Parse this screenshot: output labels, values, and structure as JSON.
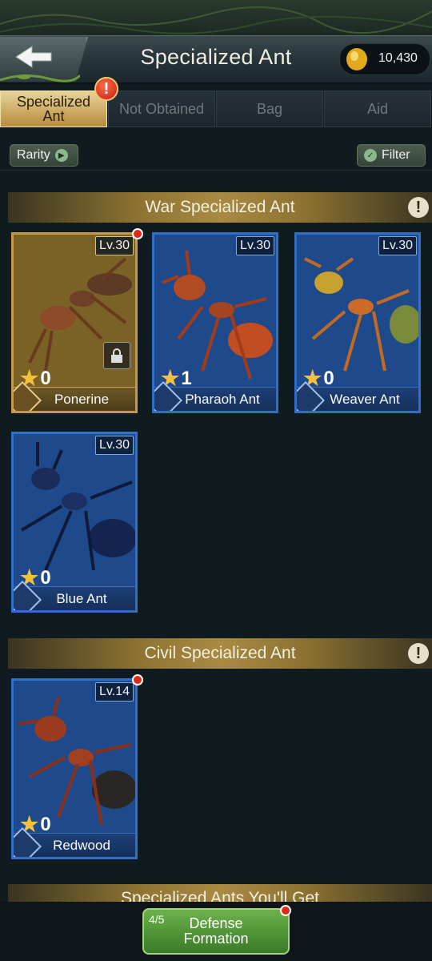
{
  "header": {
    "title": "Specialized Ant",
    "back_icon": "back-arrow-icon",
    "currency": {
      "icon": "amber-icon",
      "value": "10,430"
    }
  },
  "tabs": [
    {
      "label": "Specialized Ant",
      "active": true
    },
    {
      "label": "Not Obtained",
      "active": false
    },
    {
      "label": "Bag",
      "active": false
    },
    {
      "label": "Aid",
      "active": false
    }
  ],
  "tab_badge": "!",
  "filters": {
    "rarity_label": "Rarity",
    "filter_label": "Filter"
  },
  "sections": {
    "war": {
      "title": "War Specialized Ant",
      "info": "!",
      "cards": [
        {
          "level": "Lv.30",
          "stars": "0",
          "name": "Ponerine",
          "style": "gold",
          "type_icon": "ground-type-icon",
          "locked": true,
          "new_dot": true
        },
        {
          "level": "Lv.30",
          "stars": "1",
          "name": "Pharaoh Ant",
          "style": "blue",
          "type_icon": "claw-type-icon",
          "locked": false,
          "new_dot": false
        },
        {
          "level": "Lv.30",
          "stars": "0",
          "name": "Weaver Ant",
          "style": "blue",
          "type_icon": "claw-type-icon",
          "locked": false,
          "new_dot": false
        },
        {
          "level": "Lv.30",
          "stars": "0",
          "name": "Blue Ant",
          "style": "blue",
          "type_icon": "boot-type-icon",
          "locked": false,
          "new_dot": false
        }
      ]
    },
    "civil": {
      "title": "Civil Specialized Ant",
      "info": "!",
      "cards": [
        {
          "level": "Lv.14",
          "stars": "0",
          "name": "Redwood",
          "style": "blue",
          "type_icon": "book-type-icon",
          "locked": false,
          "new_dot": true
        }
      ]
    },
    "upcoming": {
      "title": "Specialized Ants You'll Get"
    }
  },
  "defense": {
    "label_line1": "Defense",
    "label_line2": "Formation",
    "count": "4/5"
  },
  "colors": {
    "gold_card": "#c39a4a",
    "blue_card": "#2f6fc8",
    "badge_red": "#e22a1c",
    "button_green": "#5aa23c"
  }
}
